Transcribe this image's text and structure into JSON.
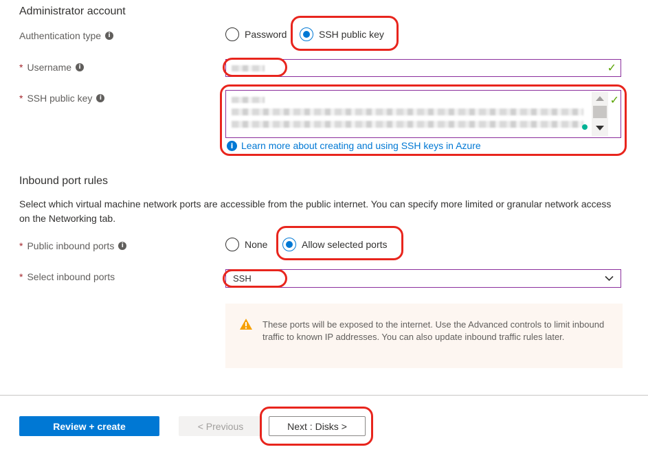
{
  "admin": {
    "section_title": "Administrator account",
    "auth_type_label": "Authentication type",
    "auth_options": [
      "Password",
      "SSH public key"
    ],
    "auth_selected": "SSH public key",
    "username_label": "Username",
    "ssh_key_label": "SSH public key",
    "ssh_learn_more": "Learn more about creating and using SSH keys in Azure"
  },
  "inbound": {
    "section_title": "Inbound port rules",
    "description": "Select which virtual machine network ports are accessible from the public internet. You can specify more limited or granular network access on the Networking tab.",
    "public_ports_label": "Public inbound ports",
    "public_ports_options": [
      "None",
      "Allow selected ports"
    ],
    "public_ports_selected": "Allow selected ports",
    "select_ports_label": "Select inbound ports",
    "select_ports_value": "SSH",
    "warning": "These ports will be exposed to the internet. Use the Advanced controls to limit inbound traffic to known IP addresses. You can also update inbound traffic rules later."
  },
  "footer": {
    "review_create": "Review + create",
    "previous": "< Previous",
    "next": "Next : Disks >"
  },
  "required_marker": "*",
  "colors": {
    "accent": "#0078d4",
    "field_border": "#8a2d9c",
    "valid_check": "#57a300",
    "highlight": "#e8251d",
    "warning": "#f7a000"
  }
}
